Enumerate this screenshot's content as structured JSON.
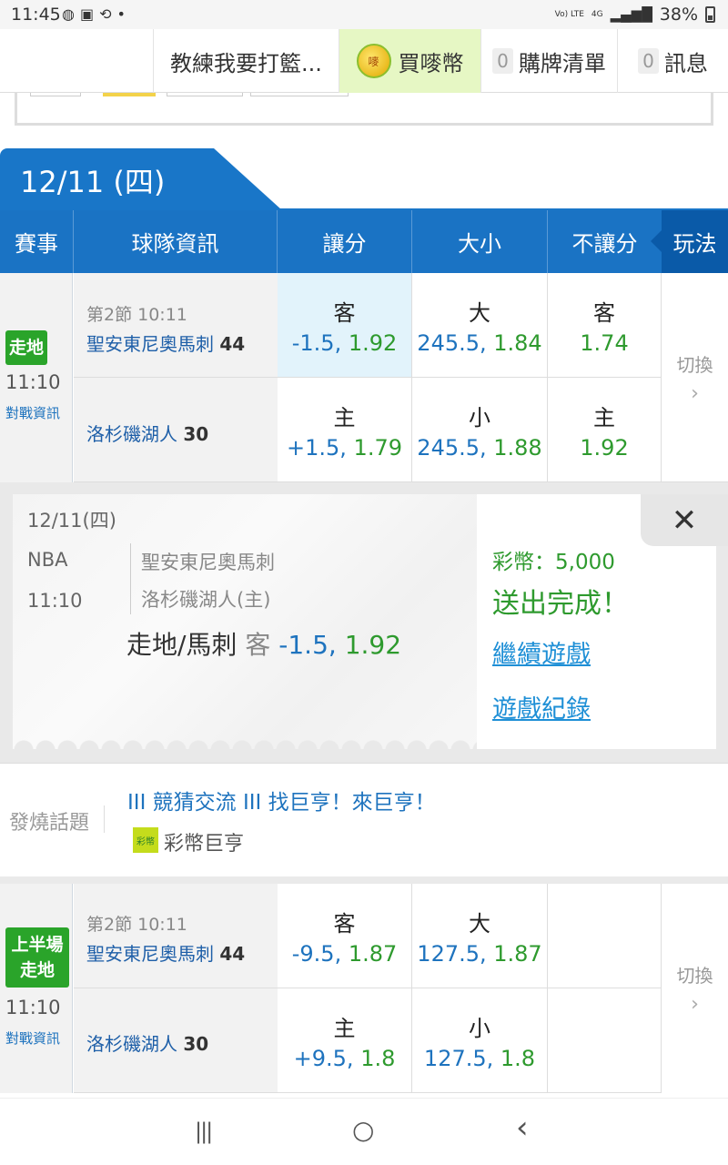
{
  "status_bar": {
    "time": "11:45",
    "battery": "38%",
    "network_top": "Vo) LTE",
    "network_mid": "4G"
  },
  "top_nav": {
    "item1": "教練我要打籃...",
    "item2": "買嘜幣",
    "coin_icon_text": "嘜",
    "item3_count": "0",
    "item3": "購牌清單",
    "item4_count": "0",
    "item4": "訊息"
  },
  "date_tab": "12/11 (四)",
  "table_header": {
    "event": "賽事",
    "team_info": "球隊資訊",
    "spread": "讓分",
    "total": "大小",
    "moneyline": "不讓分",
    "play": "玩法"
  },
  "game1": {
    "badge": "走地",
    "time": "11:10",
    "info_link": "對戰資訊",
    "period": "第2節 10:11",
    "away_team": "聖安東尼奧馬刺",
    "away_score": "44",
    "home_team": "洛杉磯湖人",
    "home_score": "30",
    "spread_away_side": "客",
    "spread_away_line": "-1.5, ",
    "spread_away_price": "1.92",
    "spread_home_side": "主",
    "spread_home_line": "+1.5, ",
    "spread_home_price": "1.79",
    "total_over_side": "大",
    "total_over_line": "245.5, ",
    "total_over_price": "1.84",
    "total_under_side": "小",
    "total_under_line": "245.5, ",
    "total_under_price": "1.88",
    "ml_away_side": "客",
    "ml_away_price": "1.74",
    "ml_home_side": "主",
    "ml_home_price": "1.92",
    "switch": "切換"
  },
  "confirmation": {
    "date": "12/11(四)",
    "league": "NBA",
    "time": "11:10",
    "away": "聖安東尼奧馬刺",
    "home": "洛杉磯湖人(主)",
    "bet_type": "走地/馬刺",
    "bet_side": "客",
    "bet_line": "-1.5, ",
    "bet_price": "1.92",
    "coins": "彩幣：5,000",
    "done": "送出完成！",
    "continue": "繼續遊戲",
    "history": "遊戲紀錄",
    "close": "✕"
  },
  "hot_topic": {
    "label": "發燒話題",
    "title": "III 競猜交流 III 找巨亨！來巨亨！",
    "icon_text": "彩幣",
    "author": "彩幣巨亨"
  },
  "game2": {
    "badge_line1": "上半場",
    "badge_line2": "走地",
    "time": "11:10",
    "info_link": "對戰資訊",
    "period": "第2節 10:11",
    "away_team": "聖安東尼奧馬刺",
    "away_score": "44",
    "home_team": "洛杉磯湖人",
    "home_score": "30",
    "spread_away_side": "客",
    "spread_away_line": "-9.5, ",
    "spread_away_price": "1.87",
    "spread_home_side": "主",
    "spread_home_line": "+9.5, ",
    "spread_home_price": "1.8",
    "total_over_side": "大",
    "total_over_line": "127.5, ",
    "total_over_price": "1.87",
    "total_under_side": "小",
    "total_under_line": "127.5, ",
    "total_under_price": "1.8",
    "switch": "切換"
  },
  "nav_bar": {
    "recent": "|||",
    "home": "○",
    "back": "‹"
  }
}
